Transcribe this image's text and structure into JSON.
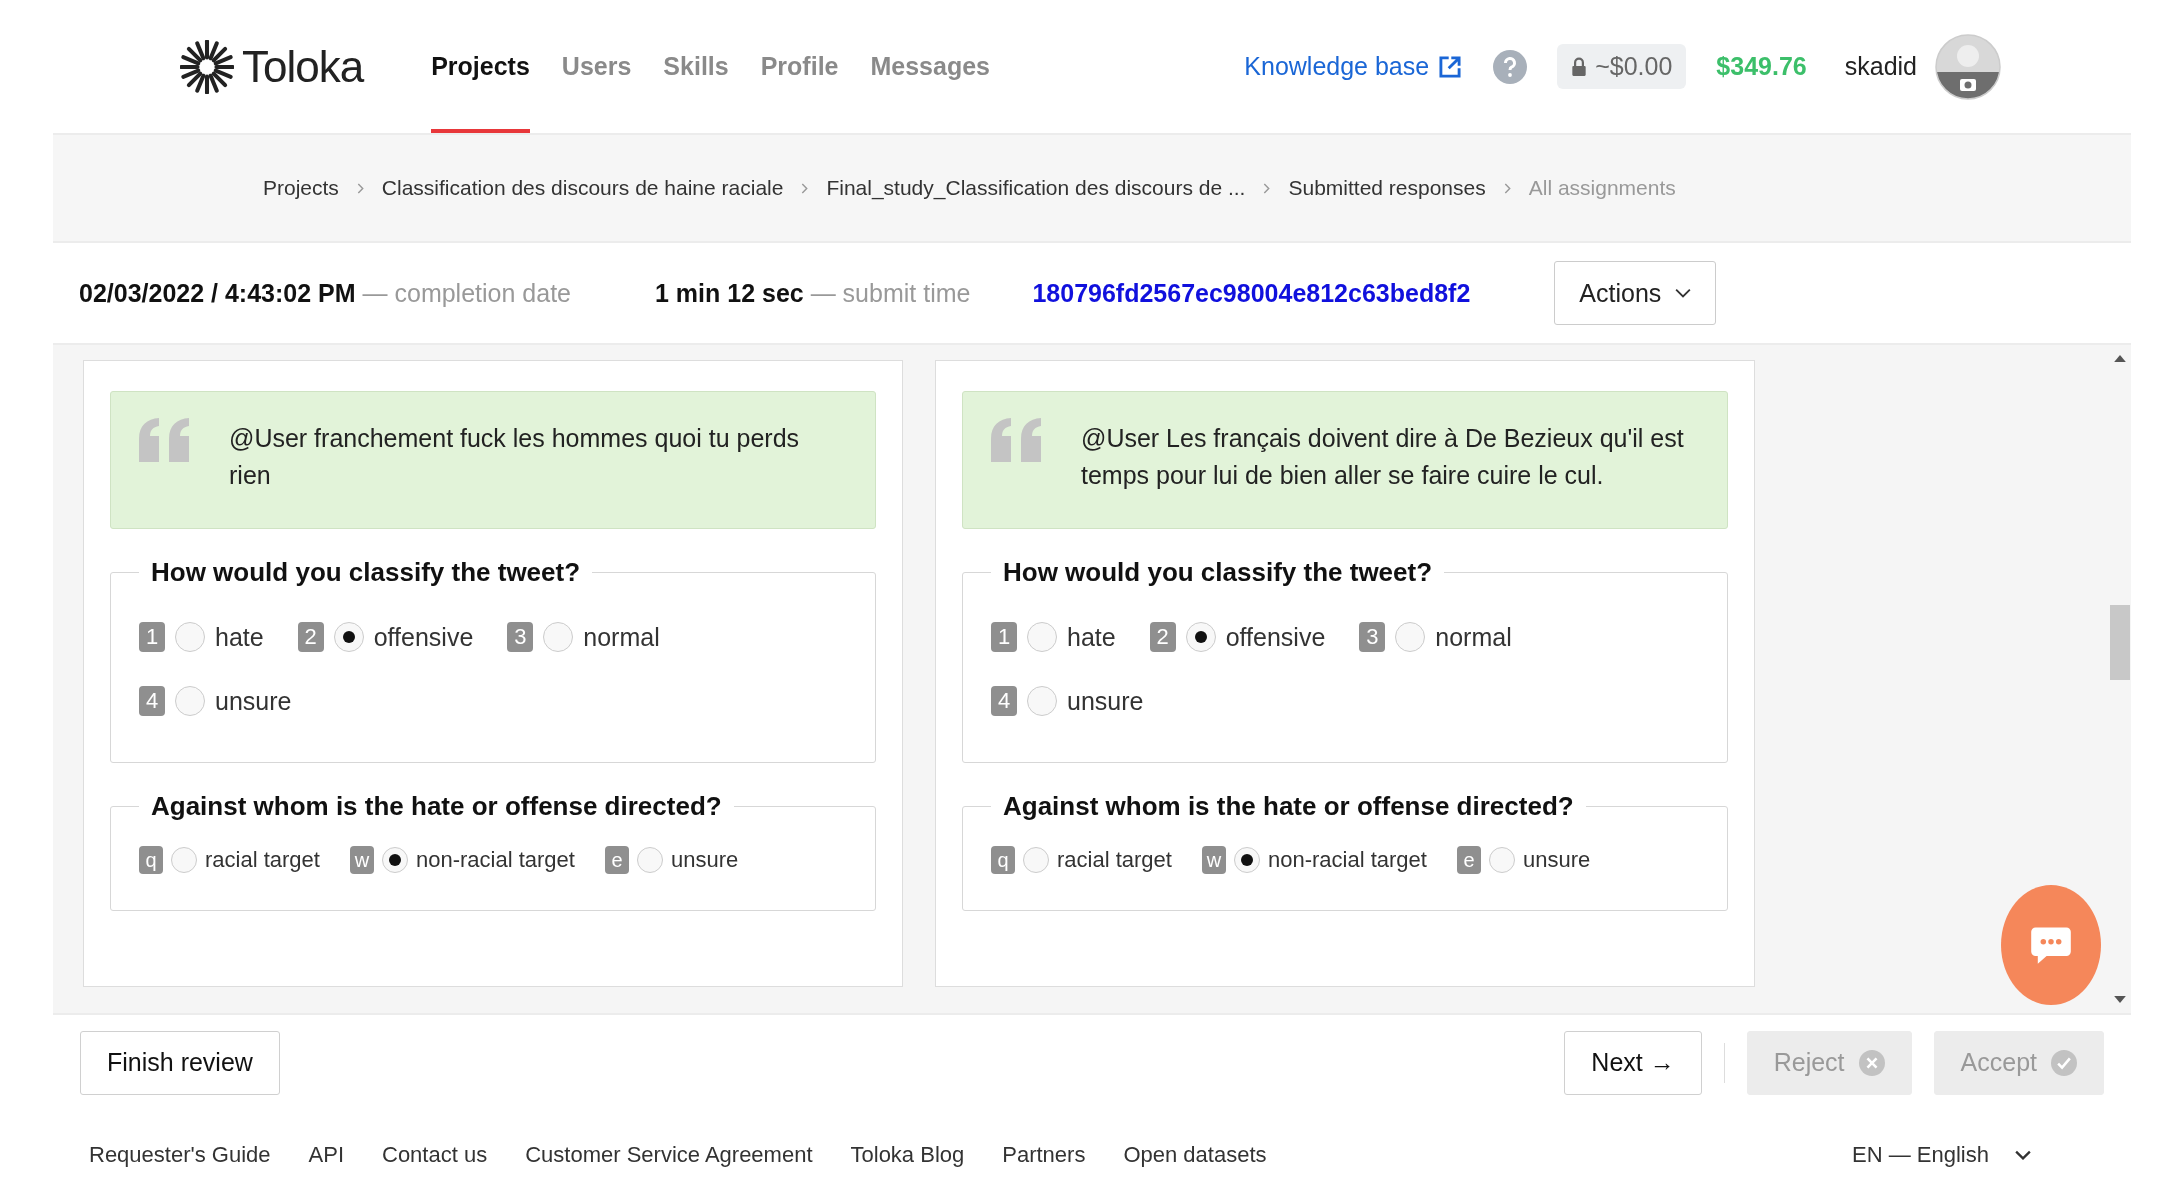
{
  "header": {
    "logo": "Toloka",
    "nav": [
      {
        "label": "Projects",
        "selected": true
      },
      {
        "label": "Users",
        "selected": false
      },
      {
        "label": "Skills",
        "selected": false
      },
      {
        "label": "Profile",
        "selected": false
      },
      {
        "label": "Messages",
        "selected": false
      }
    ],
    "knowledge_base": "Knowledge base",
    "locked_balance": "~$0.00",
    "balance": "$349.76",
    "username": "skadid"
  },
  "breadcrumbs": [
    {
      "label": "Projects",
      "current": false
    },
    {
      "label": "Classification des discours de haine raciale",
      "current": false
    },
    {
      "label": "Final_study_Classification des discours de ...",
      "current": false
    },
    {
      "label": "Submitted responses",
      "current": false
    },
    {
      "label": "All assignments",
      "current": true
    }
  ],
  "assignment": {
    "completion_date": "02/03/2022 / 4:43:02 PM",
    "completion_label": "— completion date",
    "submit_time": "1 min 12 sec",
    "submit_label": "— submit time",
    "id": "180796fd2567ec98004e812c63bed8f2",
    "actions": "Actions"
  },
  "cards": [
    {
      "tweet": "@User franchement fuck les hommes quoi tu perds rien",
      "questions": [
        {
          "title": "How would you classify the tweet?",
          "options": [
            {
              "key": "1",
              "label": "hate",
              "selected": false
            },
            {
              "key": "2",
              "label": "offensive",
              "selected": true
            },
            {
              "key": "3",
              "label": "normal",
              "selected": false
            },
            {
              "key": "4",
              "label": "unsure",
              "selected": false
            }
          ]
        },
        {
          "title": "Against whom is the hate or offense directed?",
          "options": [
            {
              "key": "q",
              "label": "racial target",
              "selected": false
            },
            {
              "key": "w",
              "label": "non-racial target",
              "selected": true
            },
            {
              "key": "e",
              "label": "unsure",
              "selected": false
            }
          ]
        }
      ]
    },
    {
      "tweet": "@User Les français doivent dire à De Bezieux qu'il est temps pour lui de bien aller se faire cuire le cul.",
      "questions": [
        {
          "title": "How would you classify the tweet?",
          "options": [
            {
              "key": "1",
              "label": "hate",
              "selected": false
            },
            {
              "key": "2",
              "label": "offensive",
              "selected": true
            },
            {
              "key": "3",
              "label": "normal",
              "selected": false
            },
            {
              "key": "4",
              "label": "unsure",
              "selected": false
            }
          ]
        },
        {
          "title": "Against whom is the hate or offense directed?",
          "options": [
            {
              "key": "q",
              "label": "racial target",
              "selected": false
            },
            {
              "key": "w",
              "label": "non-racial target",
              "selected": true
            },
            {
              "key": "e",
              "label": "unsure",
              "selected": false
            }
          ]
        }
      ]
    }
  ],
  "review_bar": {
    "finish": "Finish review",
    "next": "Next →",
    "reject": {
      "label": "Reject",
      "disabled": true
    },
    "accept": {
      "label": "Accept",
      "disabled": true
    }
  },
  "footer": {
    "links": [
      "Requester's Guide",
      "API",
      "Contact us",
      "Customer Service Agreement",
      "Toloka Blog",
      "Partners",
      "Open datasets"
    ],
    "language": "EN — English"
  }
}
